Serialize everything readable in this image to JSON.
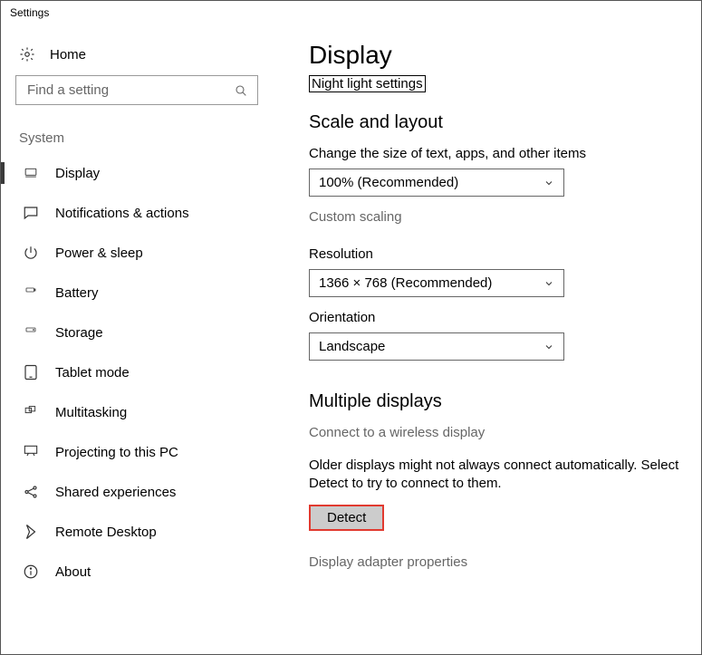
{
  "window_title": "Settings",
  "sidebar": {
    "home_label": "Home",
    "search_placeholder": "Find a setting",
    "category": "System",
    "items": [
      {
        "label": "Display"
      },
      {
        "label": "Notifications & actions"
      },
      {
        "label": "Power & sleep"
      },
      {
        "label": "Battery"
      },
      {
        "label": "Storage"
      },
      {
        "label": "Tablet mode"
      },
      {
        "label": "Multitasking"
      },
      {
        "label": "Projecting to this PC"
      },
      {
        "label": "Shared experiences"
      },
      {
        "label": "Remote Desktop"
      },
      {
        "label": "About"
      }
    ]
  },
  "main": {
    "title": "Display",
    "night_light_link": "Night light settings",
    "scale_heading": "Scale and layout",
    "scale_label": "Change the size of text, apps, and other items",
    "scale_value": "100% (Recommended)",
    "custom_scaling": "Custom scaling",
    "resolution_label": "Resolution",
    "resolution_value": "1366 × 768 (Recommended)",
    "orientation_label": "Orientation",
    "orientation_value": "Landscape",
    "multiple_heading": "Multiple displays",
    "wireless_link": "Connect to a wireless display",
    "older_text": "Older displays might not always connect automatically. Select Detect to try to connect to them.",
    "detect_button": "Detect",
    "adapter_link": "Display adapter properties"
  }
}
